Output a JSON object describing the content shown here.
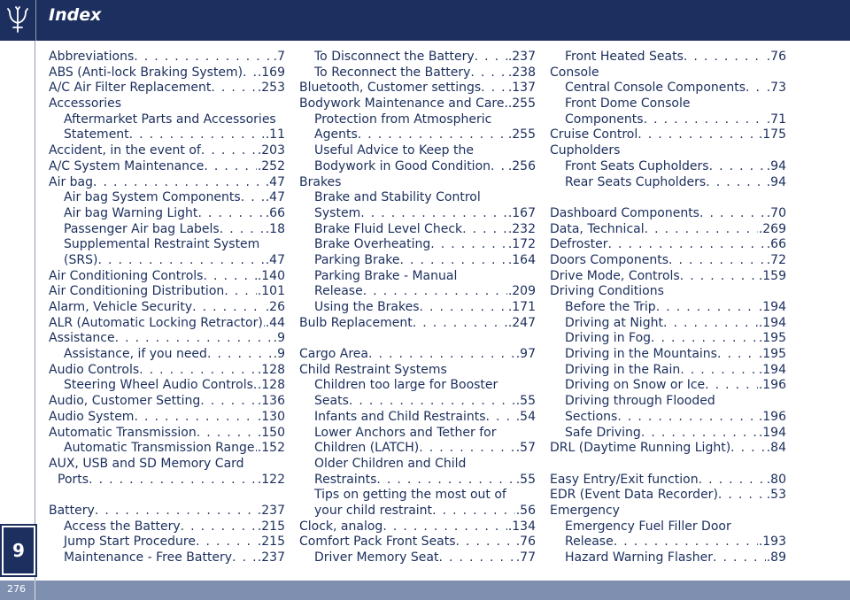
{
  "header": {
    "title": "Index"
  },
  "chapter": "9",
  "page_number": "276",
  "columns": [
    [
      {
        "level": 0,
        "text": "Abbreviations",
        "page": ".7"
      },
      {
        "level": 0,
        "text": "ABS (Anti-lock Braking System)",
        "page": ".169"
      },
      {
        "level": 0,
        "text": "A/C Air Filter Replacement",
        "page": ".253"
      },
      {
        "level": 0,
        "text": "Accessories"
      },
      {
        "level": 1,
        "text": "Aftermarket Parts and Accessories"
      },
      {
        "level": 1,
        "text": "Statement",
        "page": ".11"
      },
      {
        "level": 0,
        "text": "Accident, in the event of",
        "page": ".203"
      },
      {
        "level": 0,
        "text": "A/C System Maintenance",
        "page": ".252"
      },
      {
        "level": 0,
        "text": "Air bag",
        "page": ".47"
      },
      {
        "level": 1,
        "text": "Air bag System Components",
        "page": ".47"
      },
      {
        "level": 1,
        "text": "Air bag Warning Light",
        "page": ".66"
      },
      {
        "level": 1,
        "text": "Passenger Air bag Labels",
        "page": ".18"
      },
      {
        "level": 1,
        "text": "Supplemental Restraint System"
      },
      {
        "level": 1,
        "text": "(SRS)",
        "page": ".47"
      },
      {
        "level": 0,
        "text": "Air Conditioning Controls",
        "page": ".140"
      },
      {
        "level": 0,
        "text": "Air Conditioning Distribution",
        "page": ".101"
      },
      {
        "level": 0,
        "text": "Alarm, Vehicle Security",
        "page": ".26"
      },
      {
        "level": 0,
        "text": "ALR (Automatic Locking Retractor)",
        "page": ".44"
      },
      {
        "level": 0,
        "text": "Assistance",
        "page": ".9"
      },
      {
        "level": 1,
        "text": "Assistance, if you need",
        "page": ".9"
      },
      {
        "level": 0,
        "text": "Audio Controls",
        "page": ".128"
      },
      {
        "level": 1,
        "text": "Steering Wheel Audio Controls",
        "page": ".128"
      },
      {
        "level": 0,
        "text": "Audio, Customer Setting",
        "page": ".136"
      },
      {
        "level": 0,
        "text": "Audio System",
        "page": ".130"
      },
      {
        "level": 0,
        "text": "Automatic Transmission",
        "page": ".150"
      },
      {
        "level": 1,
        "text": "Automatic Transmission Range",
        "page": ".152"
      },
      {
        "level": 0,
        "text": "AUX, USB and SD Memory Card"
      },
      {
        "level": 2,
        "text": "Ports",
        "page": ".122"
      },
      {
        "level": -1
      },
      {
        "level": 0,
        "text": "Battery",
        "page": ".237"
      },
      {
        "level": 1,
        "text": "Access the Battery",
        "page": ".215"
      },
      {
        "level": 1,
        "text": "Jump Start Procedure",
        "page": ".215"
      },
      {
        "level": 1,
        "text": "Maintenance - Free Battery",
        "page": ".237"
      }
    ],
    [
      {
        "level": 1,
        "text": "To Disconnect the Battery",
        "page": ".237"
      },
      {
        "level": 1,
        "text": "To Reconnect the Battery",
        "page": ".238"
      },
      {
        "level": 0,
        "text": "Bluetooth, Customer settings",
        "page": ".137"
      },
      {
        "level": 0,
        "text": "Bodywork Maintenance and Care",
        "page": ".255"
      },
      {
        "level": 1,
        "text": "Protection from Atmospheric"
      },
      {
        "level": 1,
        "text": "Agents",
        "page": ".255"
      },
      {
        "level": 1,
        "text": "Useful Advice to Keep the"
      },
      {
        "level": 1,
        "text": "Bodywork in Good Condition",
        "page": ".256"
      },
      {
        "level": 0,
        "text": "Brakes"
      },
      {
        "level": 1,
        "text": "Brake and Stability Control"
      },
      {
        "level": 1,
        "text": "System",
        "page": ".167"
      },
      {
        "level": 1,
        "text": "Brake Fluid Level Check",
        "page": ".232"
      },
      {
        "level": 1,
        "text": "Brake Overheating",
        "page": ".172"
      },
      {
        "level": 1,
        "text": "Parking Brake",
        "page": ".164"
      },
      {
        "level": 1,
        "text": "Parking Brake - Manual"
      },
      {
        "level": 1,
        "text": "Release",
        "page": ".209"
      },
      {
        "level": 1,
        "text": "Using the Brakes",
        "page": ".171"
      },
      {
        "level": 0,
        "text": "Bulb Replacement",
        "page": ".247"
      },
      {
        "level": -1
      },
      {
        "level": 0,
        "text": "Cargo Area",
        "page": ".97"
      },
      {
        "level": 0,
        "text": "Child Restraint Systems"
      },
      {
        "level": 1,
        "text": "Children too large for Booster"
      },
      {
        "level": 1,
        "text": "Seats",
        "page": ".55"
      },
      {
        "level": 1,
        "text": "Infants and Child Restraints",
        "page": ".54"
      },
      {
        "level": 1,
        "text": "Lower Anchors and Tether for"
      },
      {
        "level": 1,
        "text": "Children (LATCH)",
        "page": ".57"
      },
      {
        "level": 1,
        "text": "Older Children and Child"
      },
      {
        "level": 1,
        "text": "Restraints",
        "page": ".55"
      },
      {
        "level": 1,
        "text": "Tips on getting the most out of"
      },
      {
        "level": 1,
        "text": "your child restraint",
        "page": ".56"
      },
      {
        "level": 0,
        "text": "Clock, analog",
        "page": ".134"
      },
      {
        "level": 0,
        "text": "Comfort Pack Front Seats",
        "page": ".76"
      },
      {
        "level": 1,
        "text": "Driver Memory Seat",
        "page": ".77"
      }
    ],
    [
      {
        "level": 1,
        "text": "Front Heated Seats",
        "page": ".76"
      },
      {
        "level": 0,
        "text": "Console"
      },
      {
        "level": 1,
        "text": "Central Console Components",
        "page": ".73"
      },
      {
        "level": 1,
        "text": "Front Dome Console"
      },
      {
        "level": 1,
        "text": "Components",
        "page": ".71"
      },
      {
        "level": 0,
        "text": "Cruise Control",
        "page": ".175"
      },
      {
        "level": 0,
        "text": "Cupholders"
      },
      {
        "level": 1,
        "text": "Front Seats Cupholders",
        "page": ".94"
      },
      {
        "level": 1,
        "text": "Rear Seats Cupholders",
        "page": ".94"
      },
      {
        "level": -1
      },
      {
        "level": 0,
        "text": "Dashboard Components",
        "page": ".70"
      },
      {
        "level": 0,
        "text": "Data, Technical",
        "page": ".269"
      },
      {
        "level": 0,
        "text": "Defroster",
        "page": ".66"
      },
      {
        "level": 0,
        "text": "Doors Components",
        "page": ".72"
      },
      {
        "level": 0,
        "text": "Drive Mode, Controls",
        "page": ".159"
      },
      {
        "level": 0,
        "text": "Driving Conditions"
      },
      {
        "level": 1,
        "text": "Before the Trip",
        "page": ".194"
      },
      {
        "level": 1,
        "text": "Driving at Night",
        "page": ".194"
      },
      {
        "level": 1,
        "text": "Driving in Fog",
        "page": ".195"
      },
      {
        "level": 1,
        "text": "Driving in the Mountains",
        "page": ".195"
      },
      {
        "level": 1,
        "text": "Driving in the Rain",
        "page": ".194"
      },
      {
        "level": 1,
        "text": "Driving on Snow or Ice",
        "page": ".196"
      },
      {
        "level": 1,
        "text": "Driving through Flooded"
      },
      {
        "level": 1,
        "text": "Sections",
        "page": ".196"
      },
      {
        "level": 1,
        "text": "Safe Driving",
        "page": ".194"
      },
      {
        "level": 0,
        "text": "DRL (Daytime Running Light)",
        "page": ".84"
      },
      {
        "level": -1
      },
      {
        "level": 0,
        "text": "Easy Entry/Exit function",
        "page": ".80"
      },
      {
        "level": 0,
        "text": "EDR (Event Data Recorder)",
        "page": ".53"
      },
      {
        "level": 0,
        "text": "Emergency"
      },
      {
        "level": 1,
        "text": "Emergency Fuel Filler Door"
      },
      {
        "level": 1,
        "text": "Release",
        "page": ".193"
      },
      {
        "level": 1,
        "text": "Hazard Warning Flasher",
        "page": ".89"
      }
    ]
  ]
}
